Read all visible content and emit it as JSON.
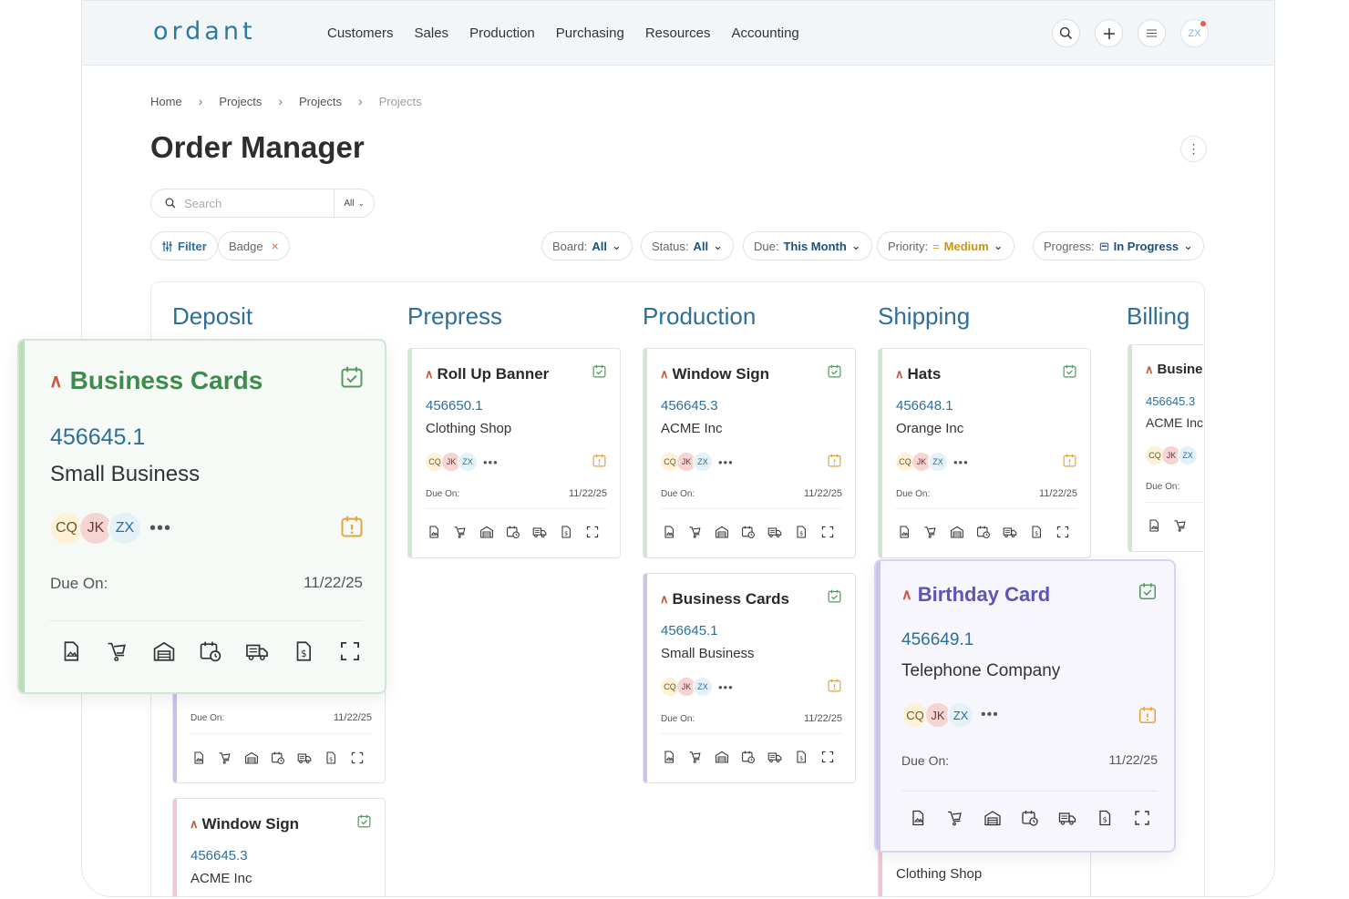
{
  "app": {
    "logo": "ordant"
  },
  "nav": [
    "Customers",
    "Sales",
    "Production",
    "Purchasing",
    "Resources",
    "Accounting"
  ],
  "user": {
    "initials": "ZX"
  },
  "breadcrumb": [
    "Home",
    "Projects",
    "Projects",
    "Projects"
  ],
  "page": {
    "title": "Order Manager"
  },
  "search": {
    "placeholder": "Search",
    "scope": "All"
  },
  "filters": {
    "filter_label": "Filter",
    "badge_label": "Badge",
    "board": {
      "label": "Board:",
      "value": "All"
    },
    "status": {
      "label": "Status:",
      "value": "All"
    },
    "due": {
      "label": "Due:",
      "value": "This Month"
    },
    "priority": {
      "label": "Priority:",
      "value": "Medium"
    },
    "progress": {
      "label": "Progress:",
      "value": "In Progress"
    }
  },
  "columns": [
    "Deposit",
    "Prepress",
    "Production",
    "Shipping",
    "Billing"
  ],
  "due_label": "Due On:",
  "more_dots": "•••",
  "assignees": [
    "CQ",
    "JK",
    "ZX"
  ],
  "colors": {
    "accent": "#2d6f98",
    "priority": "#d2553c",
    "green": "#3f8a4d",
    "purple": "#5c55b5",
    "warning": "#e9a23b"
  },
  "cards": {
    "deposit_1": {
      "title": "Business Cards",
      "number": "456645.1",
      "customer": "Small Business",
      "due": "11/22/25"
    },
    "deposit_2": {
      "due": "11/22/25"
    },
    "deposit_3": {
      "title": "Window Sign",
      "number": "456645.3",
      "customer": "ACME Inc"
    },
    "prepress_1": {
      "title": "Roll Up Banner",
      "number": "456650.1",
      "customer": "Clothing Shop",
      "due": "11/22/25"
    },
    "production_1": {
      "title": "Window Sign",
      "number": "456645.3",
      "customer": "ACME Inc",
      "due": "11/22/25"
    },
    "production_2": {
      "title": "Business Cards",
      "number": "456645.1",
      "customer": "Small Business",
      "due": "11/22/25"
    },
    "shipping_1": {
      "title": "Hats",
      "number": "456648.1",
      "customer": "Orange Inc",
      "due": "11/22/25"
    },
    "shipping_2": {
      "title": "Birthday Card",
      "number": "456649.1",
      "customer": "Telephone Company",
      "due": "11/22/25"
    },
    "shipping_3": {
      "customer": "Clothing Shop"
    },
    "billing_1": {
      "title": "Busine",
      "number": "456645.3",
      "customer": "ACME Inc"
    }
  },
  "card_actions": [
    "proof-icon",
    "cart-icon",
    "warehouse-icon",
    "schedule-icon",
    "delivery-icon",
    "invoice-icon",
    "expand-icon"
  ]
}
